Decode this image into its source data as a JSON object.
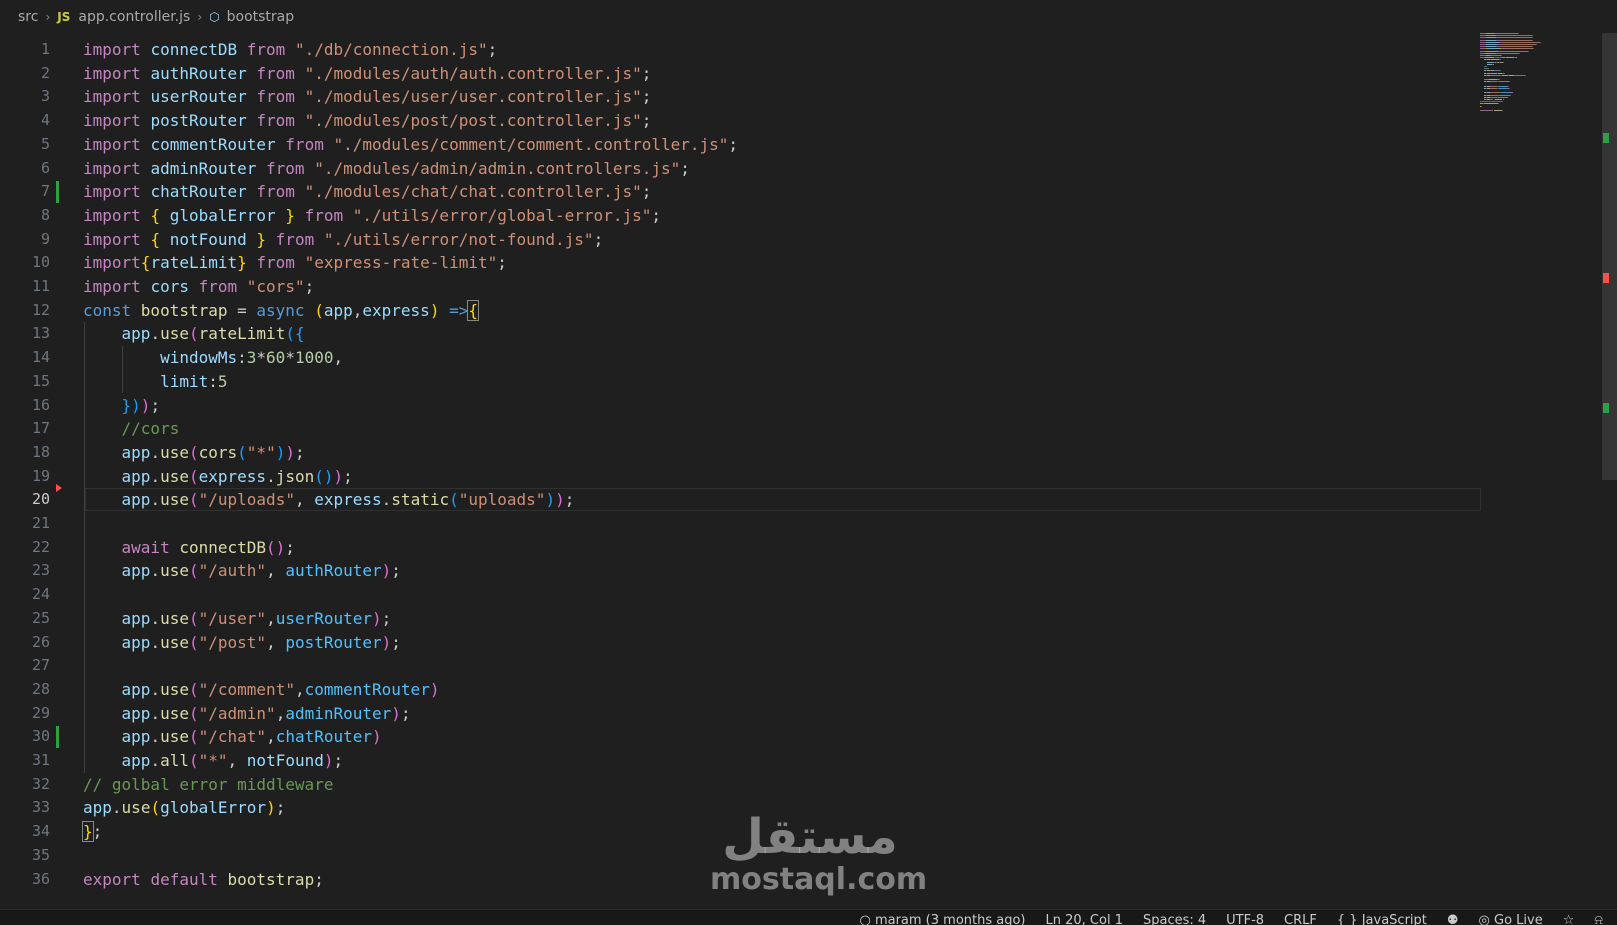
{
  "breadcrumb": {
    "folder": "src",
    "file_badge": "JS",
    "file": "app.controller.js",
    "symbol": "bootstrap",
    "symbol_icon": "symbol-method-icon"
  },
  "editor": {
    "active_line": 20,
    "lines": [
      {
        "n": "1",
        "t": [
          [
            "kw",
            "import "
          ],
          [
            "vr",
            "connectDB "
          ],
          [
            "kw",
            "from "
          ],
          [
            "str",
            "\"./db/connection.js\""
          ],
          [
            "pl",
            ";"
          ]
        ]
      },
      {
        "n": "2",
        "t": [
          [
            "kw",
            "import "
          ],
          [
            "vr",
            "authRouter "
          ],
          [
            "kw",
            "from "
          ],
          [
            "str",
            "\"./modules/auth/auth.controller.js\""
          ],
          [
            "pl",
            ";"
          ]
        ]
      },
      {
        "n": "3",
        "t": [
          [
            "kw",
            "import "
          ],
          [
            "vr",
            "userRouter "
          ],
          [
            "kw",
            "from "
          ],
          [
            "str",
            "\"./modules/user/user.controller.js\""
          ],
          [
            "pl",
            ";"
          ]
        ]
      },
      {
        "n": "4",
        "t": [
          [
            "kw",
            "import "
          ],
          [
            "vr",
            "postRouter "
          ],
          [
            "kw",
            "from "
          ],
          [
            "str",
            "\"./modules/post/post.controller.js\""
          ],
          [
            "pl",
            ";"
          ]
        ]
      },
      {
        "n": "5",
        "t": [
          [
            "kw",
            "import "
          ],
          [
            "vr",
            "commentRouter "
          ],
          [
            "kw",
            "from "
          ],
          [
            "str",
            "\"./modules/comment/comment.controller.js\""
          ],
          [
            "pl",
            ";"
          ]
        ]
      },
      {
        "n": "6",
        "t": [
          [
            "kw",
            "import "
          ],
          [
            "vr",
            "adminRouter "
          ],
          [
            "kw",
            "from "
          ],
          [
            "str",
            "\"./modules/admin/admin.controllers.js\""
          ],
          [
            "pl",
            ";"
          ]
        ]
      },
      {
        "n": "7",
        "t": [
          [
            "kw",
            "import "
          ],
          [
            "vr",
            "chatRouter "
          ],
          [
            "kw",
            "from "
          ],
          [
            "str",
            "\"./modules/chat/chat.controller.js\""
          ],
          [
            "pl",
            ";"
          ]
        ]
      },
      {
        "n": "8",
        "t": [
          [
            "kw",
            "import "
          ],
          [
            "b1",
            "{ "
          ],
          [
            "vr",
            "globalError "
          ],
          [
            "b1",
            "} "
          ],
          [
            "kw",
            "from "
          ],
          [
            "str",
            "\"./utils/error/global-error.js\""
          ],
          [
            "pl",
            ";"
          ]
        ]
      },
      {
        "n": "9",
        "t": [
          [
            "kw",
            "import "
          ],
          [
            "b1",
            "{ "
          ],
          [
            "vr",
            "notFound "
          ],
          [
            "b1",
            "} "
          ],
          [
            "kw",
            "from "
          ],
          [
            "str",
            "\"./utils/error/not-found.js\""
          ],
          [
            "pl",
            ";"
          ]
        ]
      },
      {
        "n": "10",
        "t": [
          [
            "kw",
            "import"
          ],
          [
            "b1",
            "{"
          ],
          [
            "vr",
            "rateLimit"
          ],
          [
            "b1",
            "} "
          ],
          [
            "kw",
            "from "
          ],
          [
            "str",
            "\"express-rate-limit\""
          ],
          [
            "pl",
            ";"
          ]
        ]
      },
      {
        "n": "11",
        "t": [
          [
            "kw",
            "import "
          ],
          [
            "vr",
            "cors "
          ],
          [
            "kw",
            "from "
          ],
          [
            "str",
            "\"cors\""
          ],
          [
            "pl",
            ";"
          ]
        ]
      },
      {
        "n": "12",
        "t": [
          [
            "st",
            "const "
          ],
          [
            "fn",
            "bootstrap "
          ],
          [
            "pl",
            "= "
          ],
          [
            "st",
            "async "
          ],
          [
            "b1",
            "("
          ],
          [
            "vr",
            "app"
          ],
          [
            "pl",
            ","
          ],
          [
            "vr",
            "express"
          ],
          [
            "b1",
            ") "
          ],
          [
            "st",
            "=>"
          ],
          [
            "b1m",
            "{"
          ]
        ]
      },
      {
        "n": "13",
        "t": [
          [
            "pl",
            "    "
          ],
          [
            "vr",
            "app"
          ],
          [
            "pl",
            "."
          ],
          [
            "fn",
            "use"
          ],
          [
            "b2",
            "("
          ],
          [
            "fn",
            "rateLimit"
          ],
          [
            "b3",
            "({"
          ]
        ]
      },
      {
        "n": "14",
        "t": [
          [
            "pl",
            "        "
          ],
          [
            "vr",
            "windowMs"
          ],
          [
            "pl",
            ":"
          ],
          [
            "num",
            "3"
          ],
          [
            "pl",
            "*"
          ],
          [
            "num",
            "60"
          ],
          [
            "pl",
            "*"
          ],
          [
            "num",
            "1000"
          ],
          [
            "pl",
            ","
          ]
        ]
      },
      {
        "n": "15",
        "t": [
          [
            "pl",
            "        "
          ],
          [
            "vr",
            "limit"
          ],
          [
            "pl",
            ":"
          ],
          [
            "num",
            "5"
          ]
        ]
      },
      {
        "n": "16",
        "t": [
          [
            "pl",
            "    "
          ],
          [
            "b3",
            "})"
          ],
          [
            "b2",
            ")"
          ],
          [
            "pl",
            ";"
          ]
        ]
      },
      {
        "n": "17",
        "t": [
          [
            "pl",
            "    "
          ],
          [
            "cm",
            "//cors"
          ]
        ]
      },
      {
        "n": "18",
        "t": [
          [
            "pl",
            "    "
          ],
          [
            "vr",
            "app"
          ],
          [
            "pl",
            "."
          ],
          [
            "fn",
            "use"
          ],
          [
            "b2",
            "("
          ],
          [
            "fn",
            "cors"
          ],
          [
            "b3",
            "("
          ],
          [
            "str",
            "\"*\""
          ],
          [
            "b3",
            ")"
          ],
          [
            "b2",
            ")"
          ],
          [
            "pl",
            ";"
          ]
        ]
      },
      {
        "n": "19",
        "t": [
          [
            "pl",
            "    "
          ],
          [
            "vr",
            "app"
          ],
          [
            "pl",
            "."
          ],
          [
            "fn",
            "use"
          ],
          [
            "b2",
            "("
          ],
          [
            "vr",
            "express"
          ],
          [
            "pl",
            "."
          ],
          [
            "fn",
            "json"
          ],
          [
            "b3",
            "()"
          ],
          [
            "b2",
            ")"
          ],
          [
            "pl",
            ";"
          ]
        ]
      },
      {
        "n": "20",
        "t": [
          [
            "pl",
            "    "
          ],
          [
            "vr",
            "app"
          ],
          [
            "pl",
            "."
          ],
          [
            "fn",
            "use"
          ],
          [
            "b2",
            "("
          ],
          [
            "str",
            "\"/uploads\""
          ],
          [
            "pl",
            ", "
          ],
          [
            "vr",
            "express"
          ],
          [
            "pl",
            "."
          ],
          [
            "fn",
            "static"
          ],
          [
            "b3",
            "("
          ],
          [
            "str",
            "\"uploads\""
          ],
          [
            "b3",
            ")"
          ],
          [
            "b2",
            ")"
          ],
          [
            "pl",
            ";"
          ]
        ]
      },
      {
        "n": "21",
        "t": []
      },
      {
        "n": "22",
        "t": [
          [
            "pl",
            "    "
          ],
          [
            "kw",
            "await "
          ],
          [
            "fn",
            "connectDB"
          ],
          [
            "b2",
            "()"
          ],
          [
            "pl",
            ";"
          ]
        ]
      },
      {
        "n": "23",
        "t": [
          [
            "pl",
            "    "
          ],
          [
            "vr",
            "app"
          ],
          [
            "pl",
            "."
          ],
          [
            "fn",
            "use"
          ],
          [
            "b2",
            "("
          ],
          [
            "str",
            "\"/auth\""
          ],
          [
            "pl",
            ", "
          ],
          [
            "cst",
            "authRouter"
          ],
          [
            "b2",
            ")"
          ],
          [
            "pl",
            ";"
          ]
        ]
      },
      {
        "n": "24",
        "t": []
      },
      {
        "n": "25",
        "t": [
          [
            "pl",
            "    "
          ],
          [
            "vr",
            "app"
          ],
          [
            "pl",
            "."
          ],
          [
            "fn",
            "use"
          ],
          [
            "b2",
            "("
          ],
          [
            "str",
            "\"/user\""
          ],
          [
            "pl",
            ","
          ],
          [
            "cst",
            "userRouter"
          ],
          [
            "b2",
            ")"
          ],
          [
            "pl",
            ";"
          ]
        ]
      },
      {
        "n": "26",
        "t": [
          [
            "pl",
            "    "
          ],
          [
            "vr",
            "app"
          ],
          [
            "pl",
            "."
          ],
          [
            "fn",
            "use"
          ],
          [
            "b2",
            "("
          ],
          [
            "str",
            "\"/post\""
          ],
          [
            "pl",
            ", "
          ],
          [
            "cst",
            "postRouter"
          ],
          [
            "b2",
            ")"
          ],
          [
            "pl",
            ";"
          ]
        ]
      },
      {
        "n": "27",
        "t": []
      },
      {
        "n": "28",
        "t": [
          [
            "pl",
            "    "
          ],
          [
            "vr",
            "app"
          ],
          [
            "pl",
            "."
          ],
          [
            "fn",
            "use"
          ],
          [
            "b2",
            "("
          ],
          [
            "str",
            "\"/comment\""
          ],
          [
            "pl",
            ","
          ],
          [
            "cst",
            "commentRouter"
          ],
          [
            "b2",
            ")"
          ]
        ]
      },
      {
        "n": "29",
        "t": [
          [
            "pl",
            "    "
          ],
          [
            "vr",
            "app"
          ],
          [
            "pl",
            "."
          ],
          [
            "fn",
            "use"
          ],
          [
            "b2",
            "("
          ],
          [
            "str",
            "\"/admin\""
          ],
          [
            "pl",
            ","
          ],
          [
            "cst",
            "adminRouter"
          ],
          [
            "b2",
            ")"
          ],
          [
            "pl",
            ";"
          ]
        ]
      },
      {
        "n": "30",
        "t": [
          [
            "pl",
            "    "
          ],
          [
            "vr",
            "app"
          ],
          [
            "pl",
            "."
          ],
          [
            "fn",
            "use"
          ],
          [
            "b2",
            "("
          ],
          [
            "str",
            "\"/chat\""
          ],
          [
            "pl",
            ","
          ],
          [
            "cst",
            "chatRouter"
          ],
          [
            "b2",
            ")"
          ]
        ]
      },
      {
        "n": "31",
        "t": [
          [
            "pl",
            "    "
          ],
          [
            "vr",
            "app"
          ],
          [
            "pl",
            "."
          ],
          [
            "fn",
            "all"
          ],
          [
            "b2",
            "("
          ],
          [
            "str",
            "\"*\""
          ],
          [
            "pl",
            ", "
          ],
          [
            "vr",
            "notFound"
          ],
          [
            "b2",
            ")"
          ],
          [
            "pl",
            ";"
          ]
        ]
      },
      {
        "n": "32",
        "t": [
          [
            "cm",
            "// golbal error middleware"
          ]
        ]
      },
      {
        "n": "33",
        "t": [
          [
            "vr",
            "app"
          ],
          [
            "pl",
            "."
          ],
          [
            "fn",
            "use"
          ],
          [
            "b1",
            "("
          ],
          [
            "vr",
            "globalError"
          ],
          [
            "b1",
            ")"
          ],
          [
            "pl",
            ";"
          ]
        ]
      },
      {
        "n": "34",
        "t": [
          [
            "b1m",
            "}"
          ],
          [
            "pl",
            ";"
          ]
        ]
      },
      {
        "n": "35",
        "t": []
      },
      {
        "n": "36",
        "t": [
          [
            "kw",
            "export "
          ],
          [
            "kw",
            "default "
          ],
          [
            "fn",
            "bootstrap"
          ],
          [
            "pl",
            ";"
          ]
        ]
      }
    ]
  },
  "gutter": {
    "added_lines": [
      7,
      30
    ],
    "deleted_after_lines": [
      19
    ]
  },
  "status_bar": {
    "blame": "maram (3 months ago)",
    "cursor": "Ln 20, Col 1",
    "spaces": "Spaces: 4",
    "encoding": "UTF-8",
    "eol": "CRLF",
    "language": "JavaScript",
    "go_live": "Go Live"
  },
  "watermark": {
    "arabic": "مستقل",
    "latin": "mostaql.com"
  },
  "colors": {
    "background": "#1f1f1f",
    "keyword": "#c586c0",
    "storage": "#569cd6",
    "function": "#dcdcaa",
    "string": "#ce9178",
    "variable": "#9cdcfe",
    "comment": "#6a9955",
    "added": "#2ea043",
    "deleted": "#f85149"
  }
}
